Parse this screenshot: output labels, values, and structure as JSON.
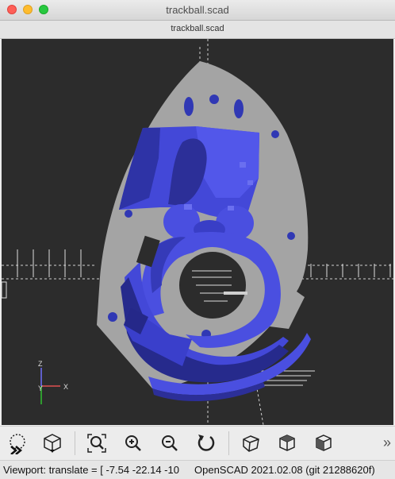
{
  "window": {
    "title": "trackball.scad"
  },
  "tab": {
    "label": "trackball.scad"
  },
  "viewport": {
    "axis_x_label": "X",
    "axis_y_label": "Y",
    "axis_z_label": "Z"
  },
  "toolbar": {
    "buttons": [
      {
        "name": "preview-button",
        "icon": "preview-icon"
      },
      {
        "name": "render-button",
        "icon": "render-icon"
      },
      {
        "name": "view-all-button",
        "icon": "zoom-fit-icon"
      },
      {
        "name": "zoom-in-button",
        "icon": "zoom-in-icon"
      },
      {
        "name": "zoom-out-button",
        "icon": "zoom-out-icon"
      },
      {
        "name": "reset-view-button",
        "icon": "reset-icon"
      },
      {
        "name": "perspective-button",
        "icon": "perspective-cube-icon"
      },
      {
        "name": "orthogonal-button",
        "icon": "ortho-cube-icon"
      },
      {
        "name": "view-button",
        "icon": "view-cube-icon"
      }
    ],
    "more": "»"
  },
  "status": {
    "left": "Viewport: translate = [ -7.54 -22.14 -10",
    "right": "OpenSCAD 2021.02.08 (git 21288620f)"
  },
  "colors": {
    "model": "#4d52e6",
    "plate": "#a4a4a4",
    "background": "#2c2c2c"
  }
}
